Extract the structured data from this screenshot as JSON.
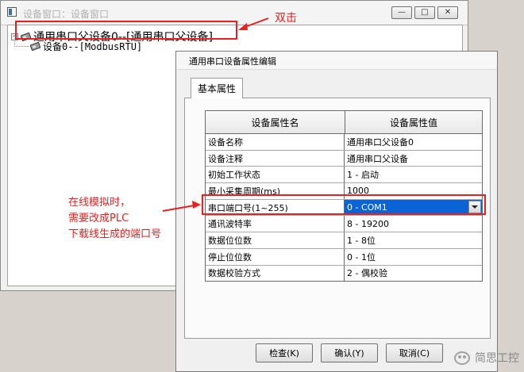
{
  "back_window": {
    "title": "设备窗口：设备窗口",
    "controls": [
      "—",
      "□",
      "✕"
    ],
    "tree": {
      "parent_label": "通用串口父设备0--[通用串口父设备]",
      "child_label": "设备0--[ModbusRTU]"
    }
  },
  "dialog": {
    "title": "通用串口设备属性编辑",
    "tab_label": "基本属性",
    "columns": [
      "设备属性名",
      "设备属性值"
    ],
    "rows": [
      {
        "name": "设备名称",
        "value": "通用串口父设备0"
      },
      {
        "name": "设备注释",
        "value": "通用串口父设备"
      },
      {
        "name": "初始工作状态",
        "value": "1 - 启动"
      },
      {
        "name": "最小采集周期(ms)",
        "value": "1000"
      },
      {
        "name": "串口端口号(1~255)",
        "value": "0 - COM1",
        "selected": true
      },
      {
        "name": "通讯波特率",
        "value": "8 - 19200"
      },
      {
        "name": "数据位位数",
        "value": "1 - 8位"
      },
      {
        "name": "停止位位数",
        "value": "0 - 1位"
      },
      {
        "name": "数据校验方式",
        "value": "2 - 偶校验"
      }
    ],
    "buttons": {
      "check": "检查(K)",
      "confirm": "确认(Y)",
      "cancel": "取消(C)"
    }
  },
  "annotations": {
    "double_click": "双击",
    "note_lines": [
      "在线模拟时，",
      "需要改成PLC",
      "下载线生成的端口号"
    ]
  },
  "watermark": "简思工控",
  "colors": {
    "annotation_red": "#e8201f",
    "selection_blue": "#0a64d6"
  }
}
